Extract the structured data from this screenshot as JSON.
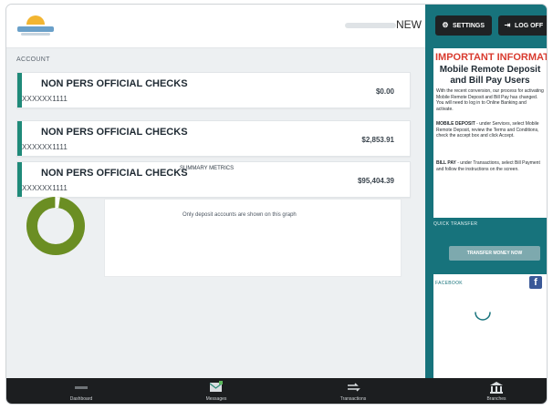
{
  "header": {
    "new_label": "NEW",
    "settings_label": "SETTINGS",
    "logoff_label": "LOG OFF"
  },
  "main": {
    "section_label": "ACCOUNT",
    "accounts": [
      {
        "name": "NON PERS OFFICIAL CHECKS",
        "number": "XXXXXX1111",
        "amount": "$0.00"
      },
      {
        "name": "NON PERS OFFICIAL CHECKS",
        "number": "XXXXXX1111",
        "amount": "$2,853.91"
      },
      {
        "name": "NON PERS OFFICIAL CHECKS",
        "number": "XXXXXX1111",
        "amount": "$95,404.39"
      }
    ],
    "metrics_title": "SUMMARY METRICS",
    "metrics_note": "Only deposit accounts are shown on this graph"
  },
  "right": {
    "important_title": "IMPORTANT INFORMATION",
    "important_subtitle_line1": "Mobile Remote Deposit",
    "important_subtitle_line2": "and Bill Pay Users",
    "intro": "With the recent conversion, our process for activating Mobile Remote Deposit and Bill Pay has changed. You will need to log in to Online Banking and activate.",
    "mobile_deposit_head": "MOBILE DEPOSIT",
    "mobile_deposit_text": "- under Services, select Mobile Remote Deposit, review the Terms and Conditions, check the accept box and click Accept.",
    "bill_pay_head": "BILL PAY",
    "bill_pay_text": "- under Transactions, select Bill Payment and follow the instructions on the screen.",
    "quick_transfer_label": "QUICK TRANSFER",
    "transfer_button": "TRANSFER MONEY NOW",
    "facebook_label": "FACEBOOK"
  },
  "tabs": {
    "dashboard": "Dashboard",
    "messages": "Messages",
    "transactions": "Transactions",
    "branches": "Branches"
  },
  "colors": {
    "accent_teal": "#17737c",
    "account_bar": "#1f8a79",
    "donut_green": "#6b8e23",
    "alert_red": "#d93b2f"
  }
}
